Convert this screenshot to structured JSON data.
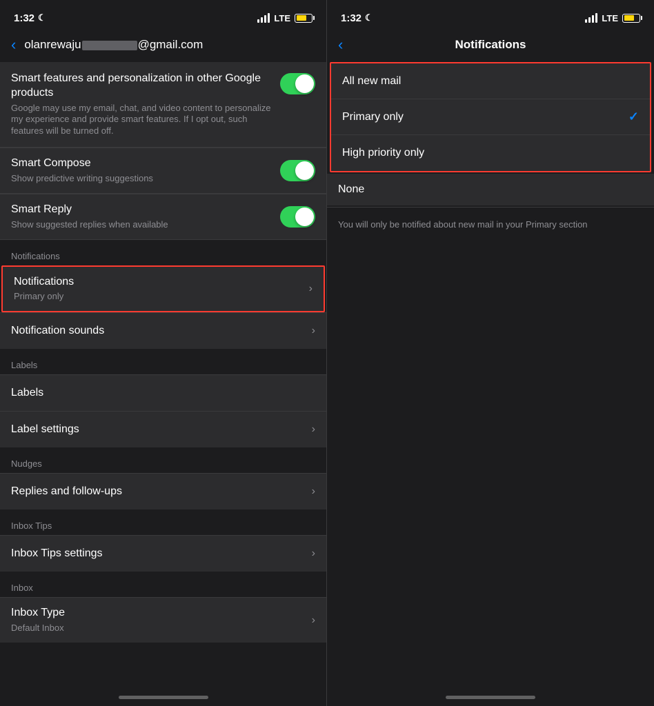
{
  "left": {
    "status": {
      "time": "1:32",
      "moon": "☾",
      "lte": "LTE"
    },
    "back_label": "‹",
    "email": "olanrewaju",
    "email_domain": "@gmail.com",
    "smart_features": {
      "title": "Smart features and personalization in other Google products",
      "subtitle": "Google may use my email, chat, and video content to personalize my experience and provide smart features. If I opt out, such features will be turned off.",
      "toggle": true
    },
    "smart_compose": {
      "title": "Smart Compose",
      "subtitle": "Show predictive writing suggestions",
      "toggle": true
    },
    "smart_reply": {
      "title": "Smart Reply",
      "subtitle": "Show suggested replies when available",
      "toggle": true
    },
    "section_notifications": "Notifications",
    "notifications_row": {
      "title": "Notifications",
      "subtitle": "Primary only"
    },
    "notification_sounds": {
      "title": "Notification sounds"
    },
    "section_labels": "Labels",
    "labels_row": {
      "title": "Labels"
    },
    "label_settings": {
      "title": "Label settings"
    },
    "section_nudges": "Nudges",
    "replies_row": {
      "title": "Replies and follow-ups"
    },
    "section_inbox_tips": "Inbox Tips",
    "inbox_tips_settings": {
      "title": "Inbox Tips settings"
    },
    "section_inbox": "Inbox",
    "inbox_type": {
      "title": "Inbox Type",
      "subtitle": "Default Inbox"
    }
  },
  "right": {
    "status": {
      "time": "1:32",
      "moon": "☾",
      "lte": "LTE"
    },
    "back_label": "‹",
    "title": "Notifications",
    "options": [
      {
        "label": "All new mail",
        "selected": false
      },
      {
        "label": "Primary only",
        "selected": true
      },
      {
        "label": "High priority only",
        "selected": false
      }
    ],
    "none_label": "None",
    "info_text": "You will only be notified about new mail in your Primary section"
  }
}
